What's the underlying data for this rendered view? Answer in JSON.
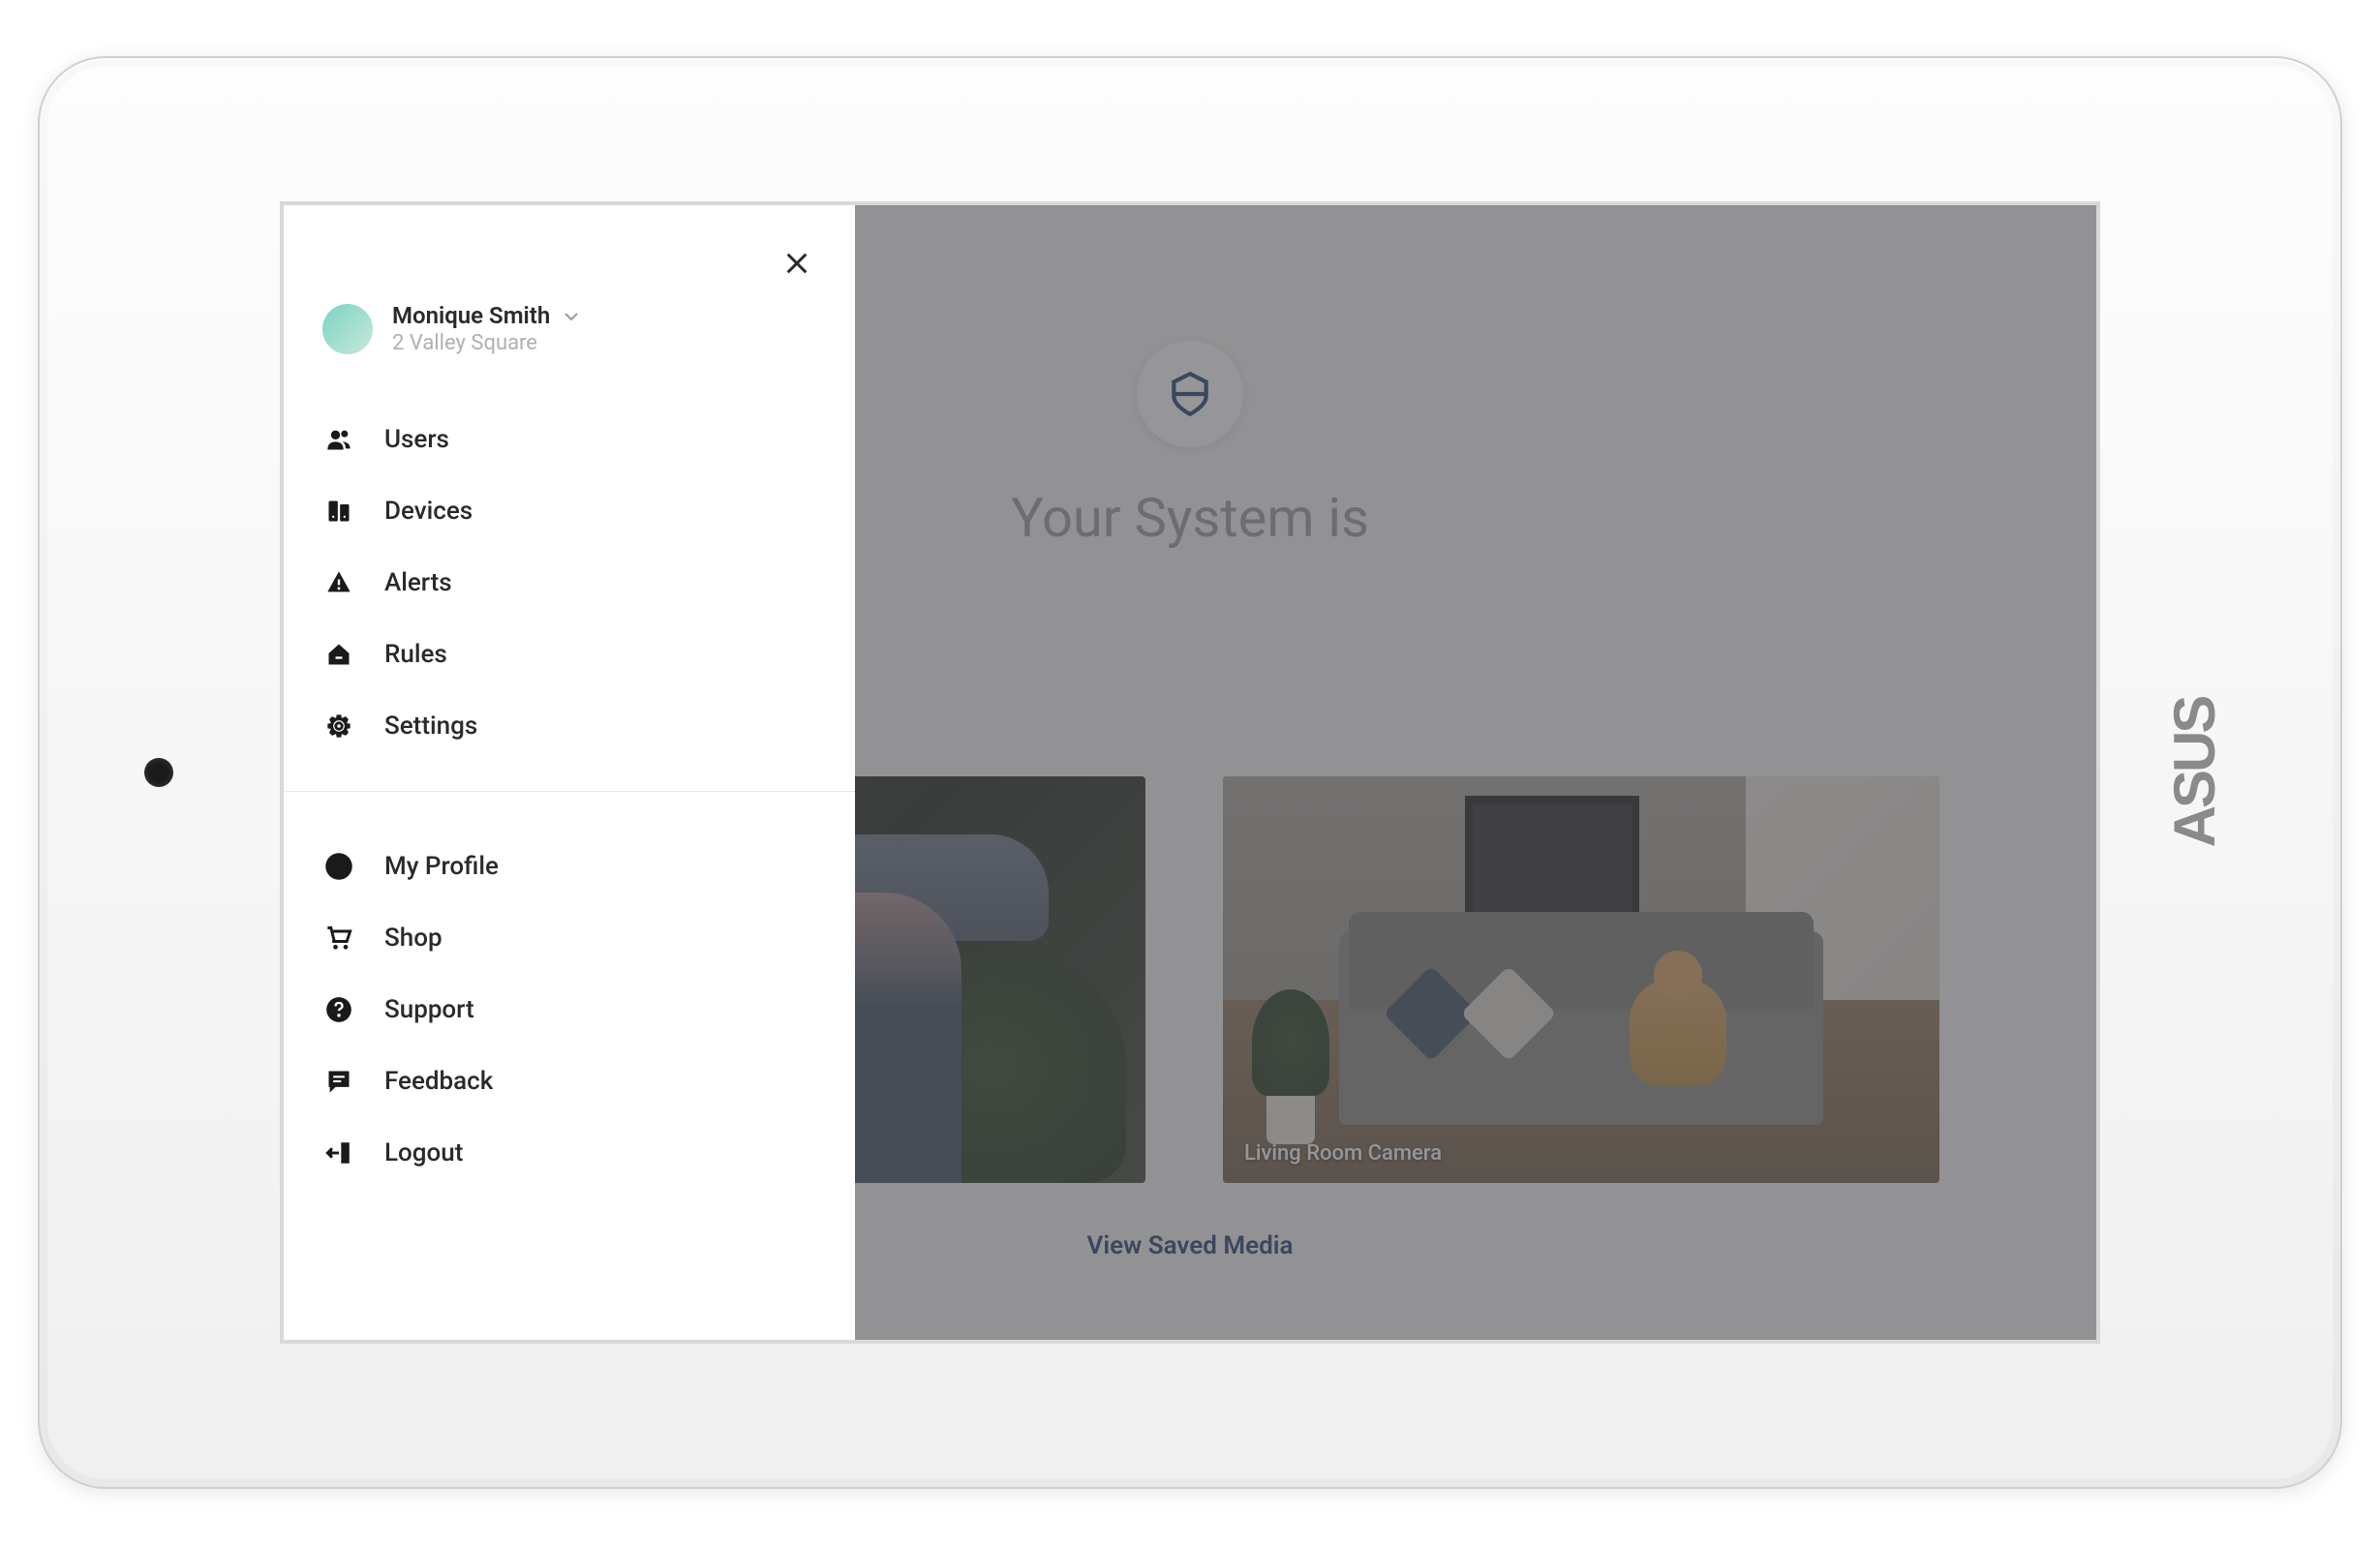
{
  "device": {
    "brand": "ASUS"
  },
  "sidebar": {
    "user_name": "Monique Smith",
    "user_address": "2 Valley Square",
    "primary_items": [
      {
        "label": "Users"
      },
      {
        "label": "Devices"
      },
      {
        "label": "Alerts"
      },
      {
        "label": "Rules"
      },
      {
        "label": "Settings"
      }
    ],
    "secondary_items": [
      {
        "label": "My Profile"
      },
      {
        "label": "Shop"
      },
      {
        "label": "Support"
      },
      {
        "label": "Feedback"
      },
      {
        "label": "Logout"
      }
    ]
  },
  "main": {
    "status_prefix": "Your System is",
    "cameras": [
      {
        "label": "Living Room Camera"
      }
    ],
    "view_media_label": "View Saved Media"
  }
}
